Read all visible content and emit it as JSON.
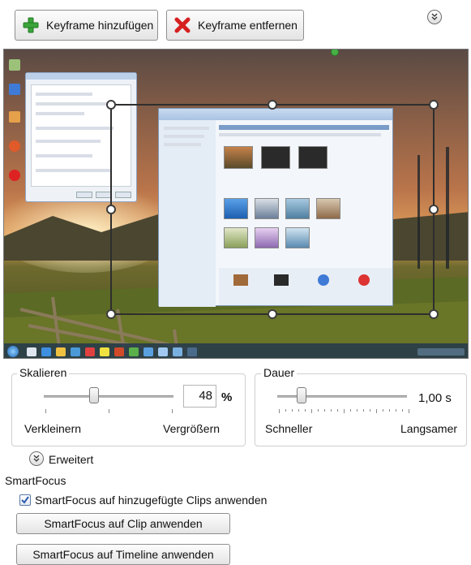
{
  "toolbar": {
    "add_keyframe": "Keyframe hinzufügen",
    "remove_keyframe": "Keyframe entfernen"
  },
  "scale": {
    "title": "Skalieren",
    "value": "48",
    "unit": "%",
    "label_min": "Verkleinern",
    "label_max": "Vergrößern",
    "slider_fraction": 0.39
  },
  "duration": {
    "title": "Dauer",
    "value": "1,00 s",
    "label_min": "Schneller",
    "label_max": "Langsamer",
    "slider_fraction": 0.19
  },
  "advanced": {
    "label": "Erweitert"
  },
  "smartfocus": {
    "heading": "SmartFocus",
    "checkbox_label": "SmartFocus auf hinzugefügte Clips anwenden",
    "checkbox_checked": true,
    "apply_clip": "SmartFocus auf Clip anwenden",
    "apply_timeline": "SmartFocus auf Timeline anwenden"
  },
  "colors": {
    "accent": "#3f6fb6",
    "check": "#2c5cb0",
    "add_icon": "#3aa43a",
    "remove_icon": "#d62020"
  }
}
